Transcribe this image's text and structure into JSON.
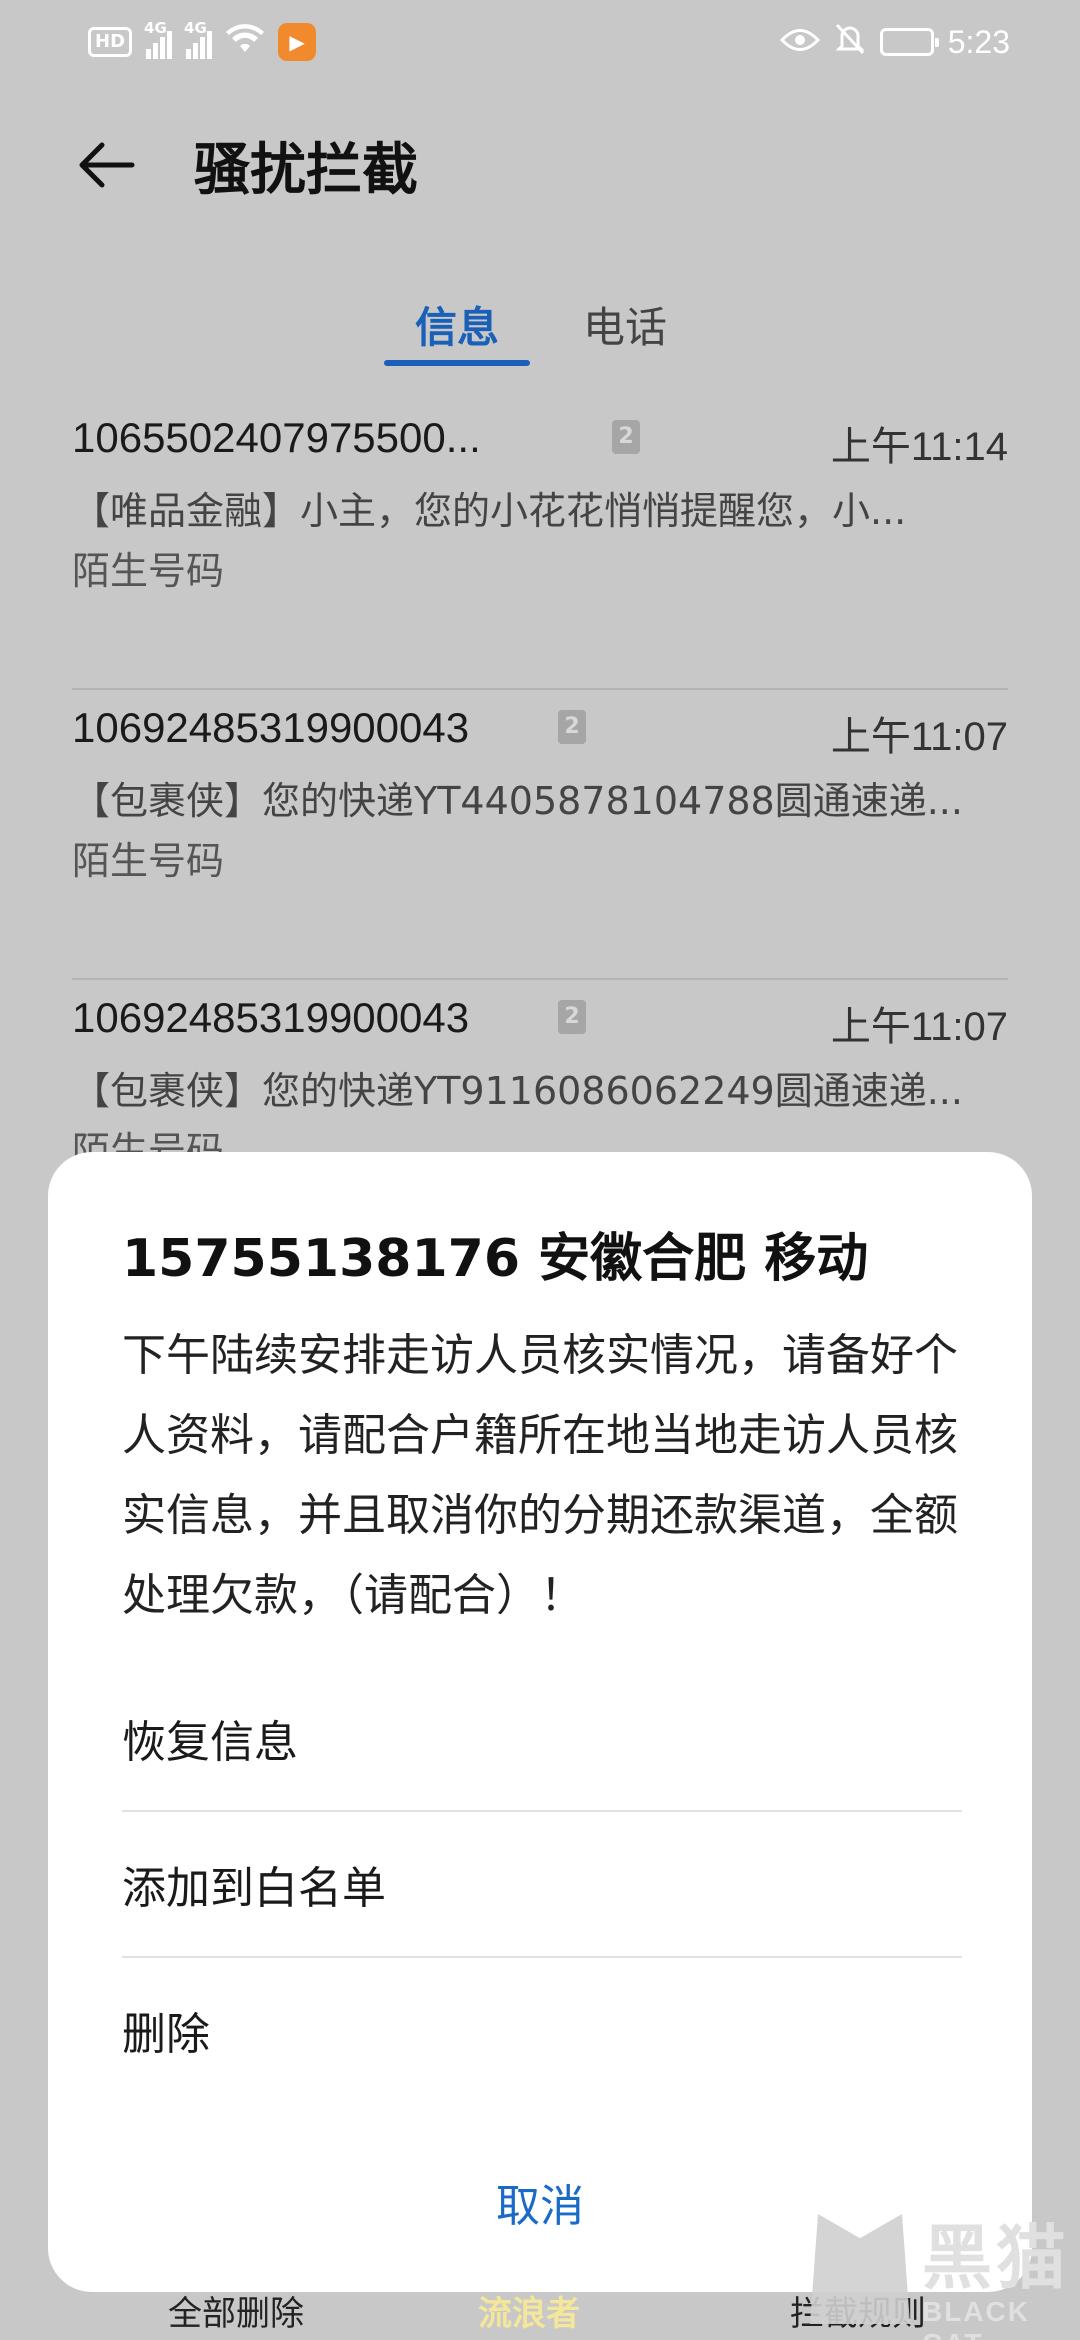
{
  "status_bar": {
    "badge": "HD",
    "net1_label": "4G",
    "net2_label": "4G",
    "time": "5:23"
  },
  "header": {
    "title": "骚扰拦截"
  },
  "tabs": [
    {
      "label": "信息",
      "active": true
    },
    {
      "label": "电话",
      "active": false
    }
  ],
  "messages": [
    {
      "sender": "1065502407975500...",
      "sim": "2",
      "time": "上午11:14",
      "preview": "【唯品金融】小主，您的小花花悄悄提醒您，小...",
      "tag": "陌生号码"
    },
    {
      "sender": "10692485319900043",
      "sim": "2",
      "time": "上午11:07",
      "preview": "【包裹侠】您的快递YT4405878104788圆通速递...",
      "tag": "陌生号码"
    },
    {
      "sender": "10692485319900043",
      "sim": "2",
      "time": "上午11:07",
      "preview": "【包裹侠】您的快递YT9116086062249圆通速递...",
      "tag": "陌生号码"
    }
  ],
  "bottom_bar": {
    "delete_all": "全部删除",
    "middle": "流浪者",
    "rules": "拦截规则"
  },
  "dialog": {
    "title": "15755138176 安徽合肥 移动",
    "body": "下午陆续安排走访人员核实情况，请备好个人资料，请配合户籍所在地当地走访人员核实信息，并且取消你的分期还款渠道，全额处理欠款，（请配合）！",
    "options": [
      "恢复信息",
      "添加到白名单",
      "删除"
    ],
    "cancel": "取消"
  },
  "watermark": {
    "text": "黑猫",
    "sub": "BLACK CAT"
  },
  "colors": {
    "accent": "#1a5fb8",
    "cancel": "#1a6ac8",
    "dim_background": "#c8c8c8"
  }
}
